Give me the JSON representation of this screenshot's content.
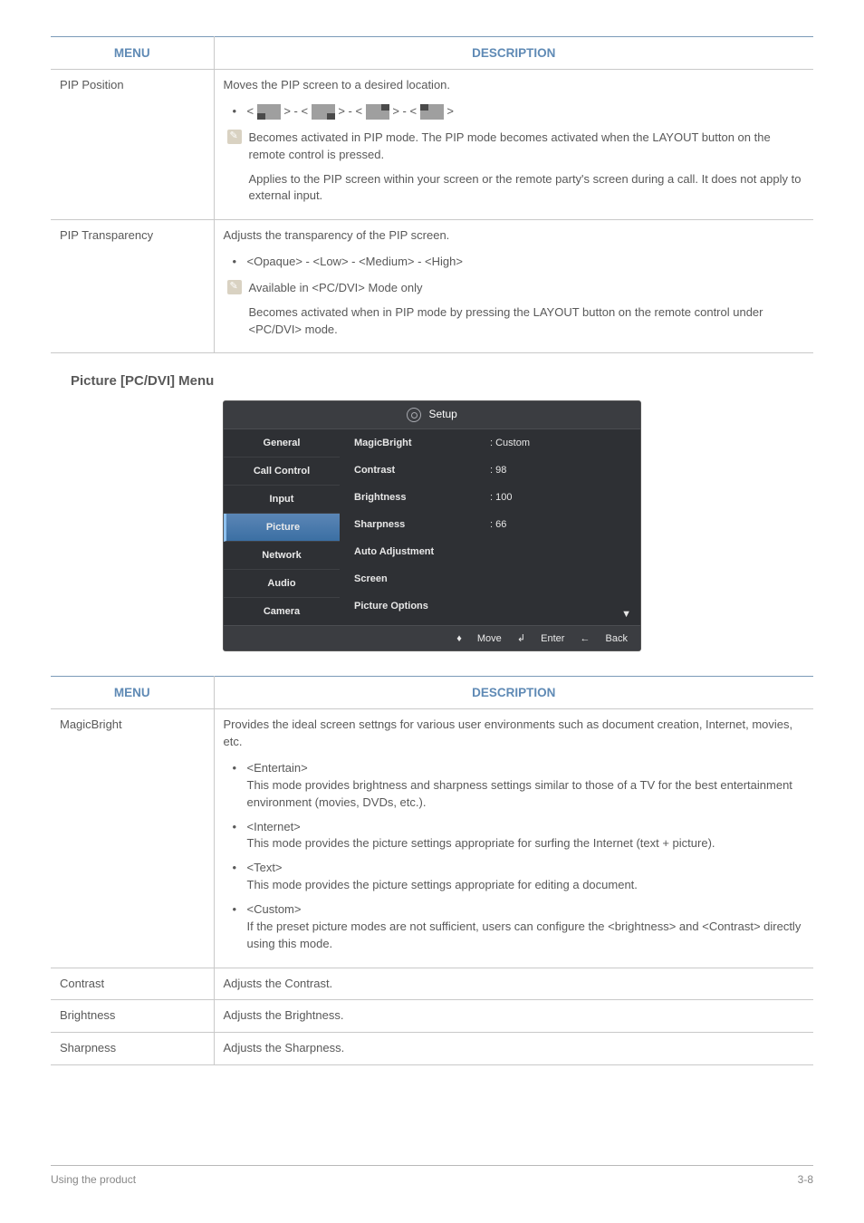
{
  "table1": {
    "headers": {
      "menu": "MENU",
      "desc": "DESCRIPTION"
    },
    "rows": [
      {
        "menu": "PIP Position",
        "intro": "Moves the PIP screen to a desired location.",
        "positions_prefix": "<",
        "positions_glue": "> - <",
        "positions_suffix": ">",
        "note1": "Becomes activated in PIP mode. The PIP mode becomes activated when the LAYOUT button on the remote control is pressed.",
        "note2": "Applies to the PIP screen within your screen or the remote party's screen during a call. It does not apply to external input."
      },
      {
        "menu": "PIP Transparency",
        "intro": "Adjusts the transparency of the PIP screen.",
        "options": "<Opaque> - <Low> - <Medium> - <High>",
        "note1": "Available in <PC/DVI> Mode only",
        "note2": "Becomes activated when in PIP mode by pressing the LAYOUT button on the remote control under <PC/DVI> mode."
      }
    ]
  },
  "section_heading": "Picture [PC/DVI] Menu",
  "osd": {
    "title": "Setup",
    "nav": [
      "General",
      "Call Control",
      "Input",
      "Picture",
      "Network",
      "Audio",
      "Camera"
    ],
    "active_index": 3,
    "rows": [
      {
        "label": "MagicBright",
        "value": ": Custom"
      },
      {
        "label": "Contrast",
        "value": ": 98"
      },
      {
        "label": "Brightness",
        "value": ": 100"
      },
      {
        "label": "Sharpness",
        "value": ": 66"
      },
      {
        "label": "Auto Adjustment",
        "value": ""
      },
      {
        "label": "Screen",
        "value": ""
      },
      {
        "label": "Picture Options",
        "value": ""
      }
    ],
    "footer": {
      "move": "Move",
      "enter": "Enter",
      "back": "Back"
    }
  },
  "table2": {
    "headers": {
      "menu": "MENU",
      "desc": "DESCRIPTION"
    },
    "rows": [
      {
        "menu": "MagicBright",
        "intro": "Provides the ideal screen settngs for various user environments such as document creation, Internet, movies, etc.",
        "items": [
          {
            "head": "<Entertain>",
            "body": "This mode provides brightness and sharpness settings similar to those of a TV for the best entertainment environment (movies, DVDs, etc.)."
          },
          {
            "head": "<Internet>",
            "body": "This mode provides the picture settings appropriate for surfing the Internet (text + picture)."
          },
          {
            "head": "<Text>",
            "body": "This mode provides the picture settings appropriate for editing a document."
          },
          {
            "head": "<Custom>",
            "body": "If the preset picture modes are not sufficient, users can configure the <brightness> and <Contrast> directly using this mode."
          }
        ]
      },
      {
        "menu": "Contrast",
        "intro": "Adjusts the Contrast."
      },
      {
        "menu": "Brightness",
        "intro": "Adjusts the Brightness."
      },
      {
        "menu": "Sharpness",
        "intro": "Adjusts the Sharpness."
      }
    ]
  },
  "footer": {
    "left": "Using the product",
    "right": "3-8"
  }
}
